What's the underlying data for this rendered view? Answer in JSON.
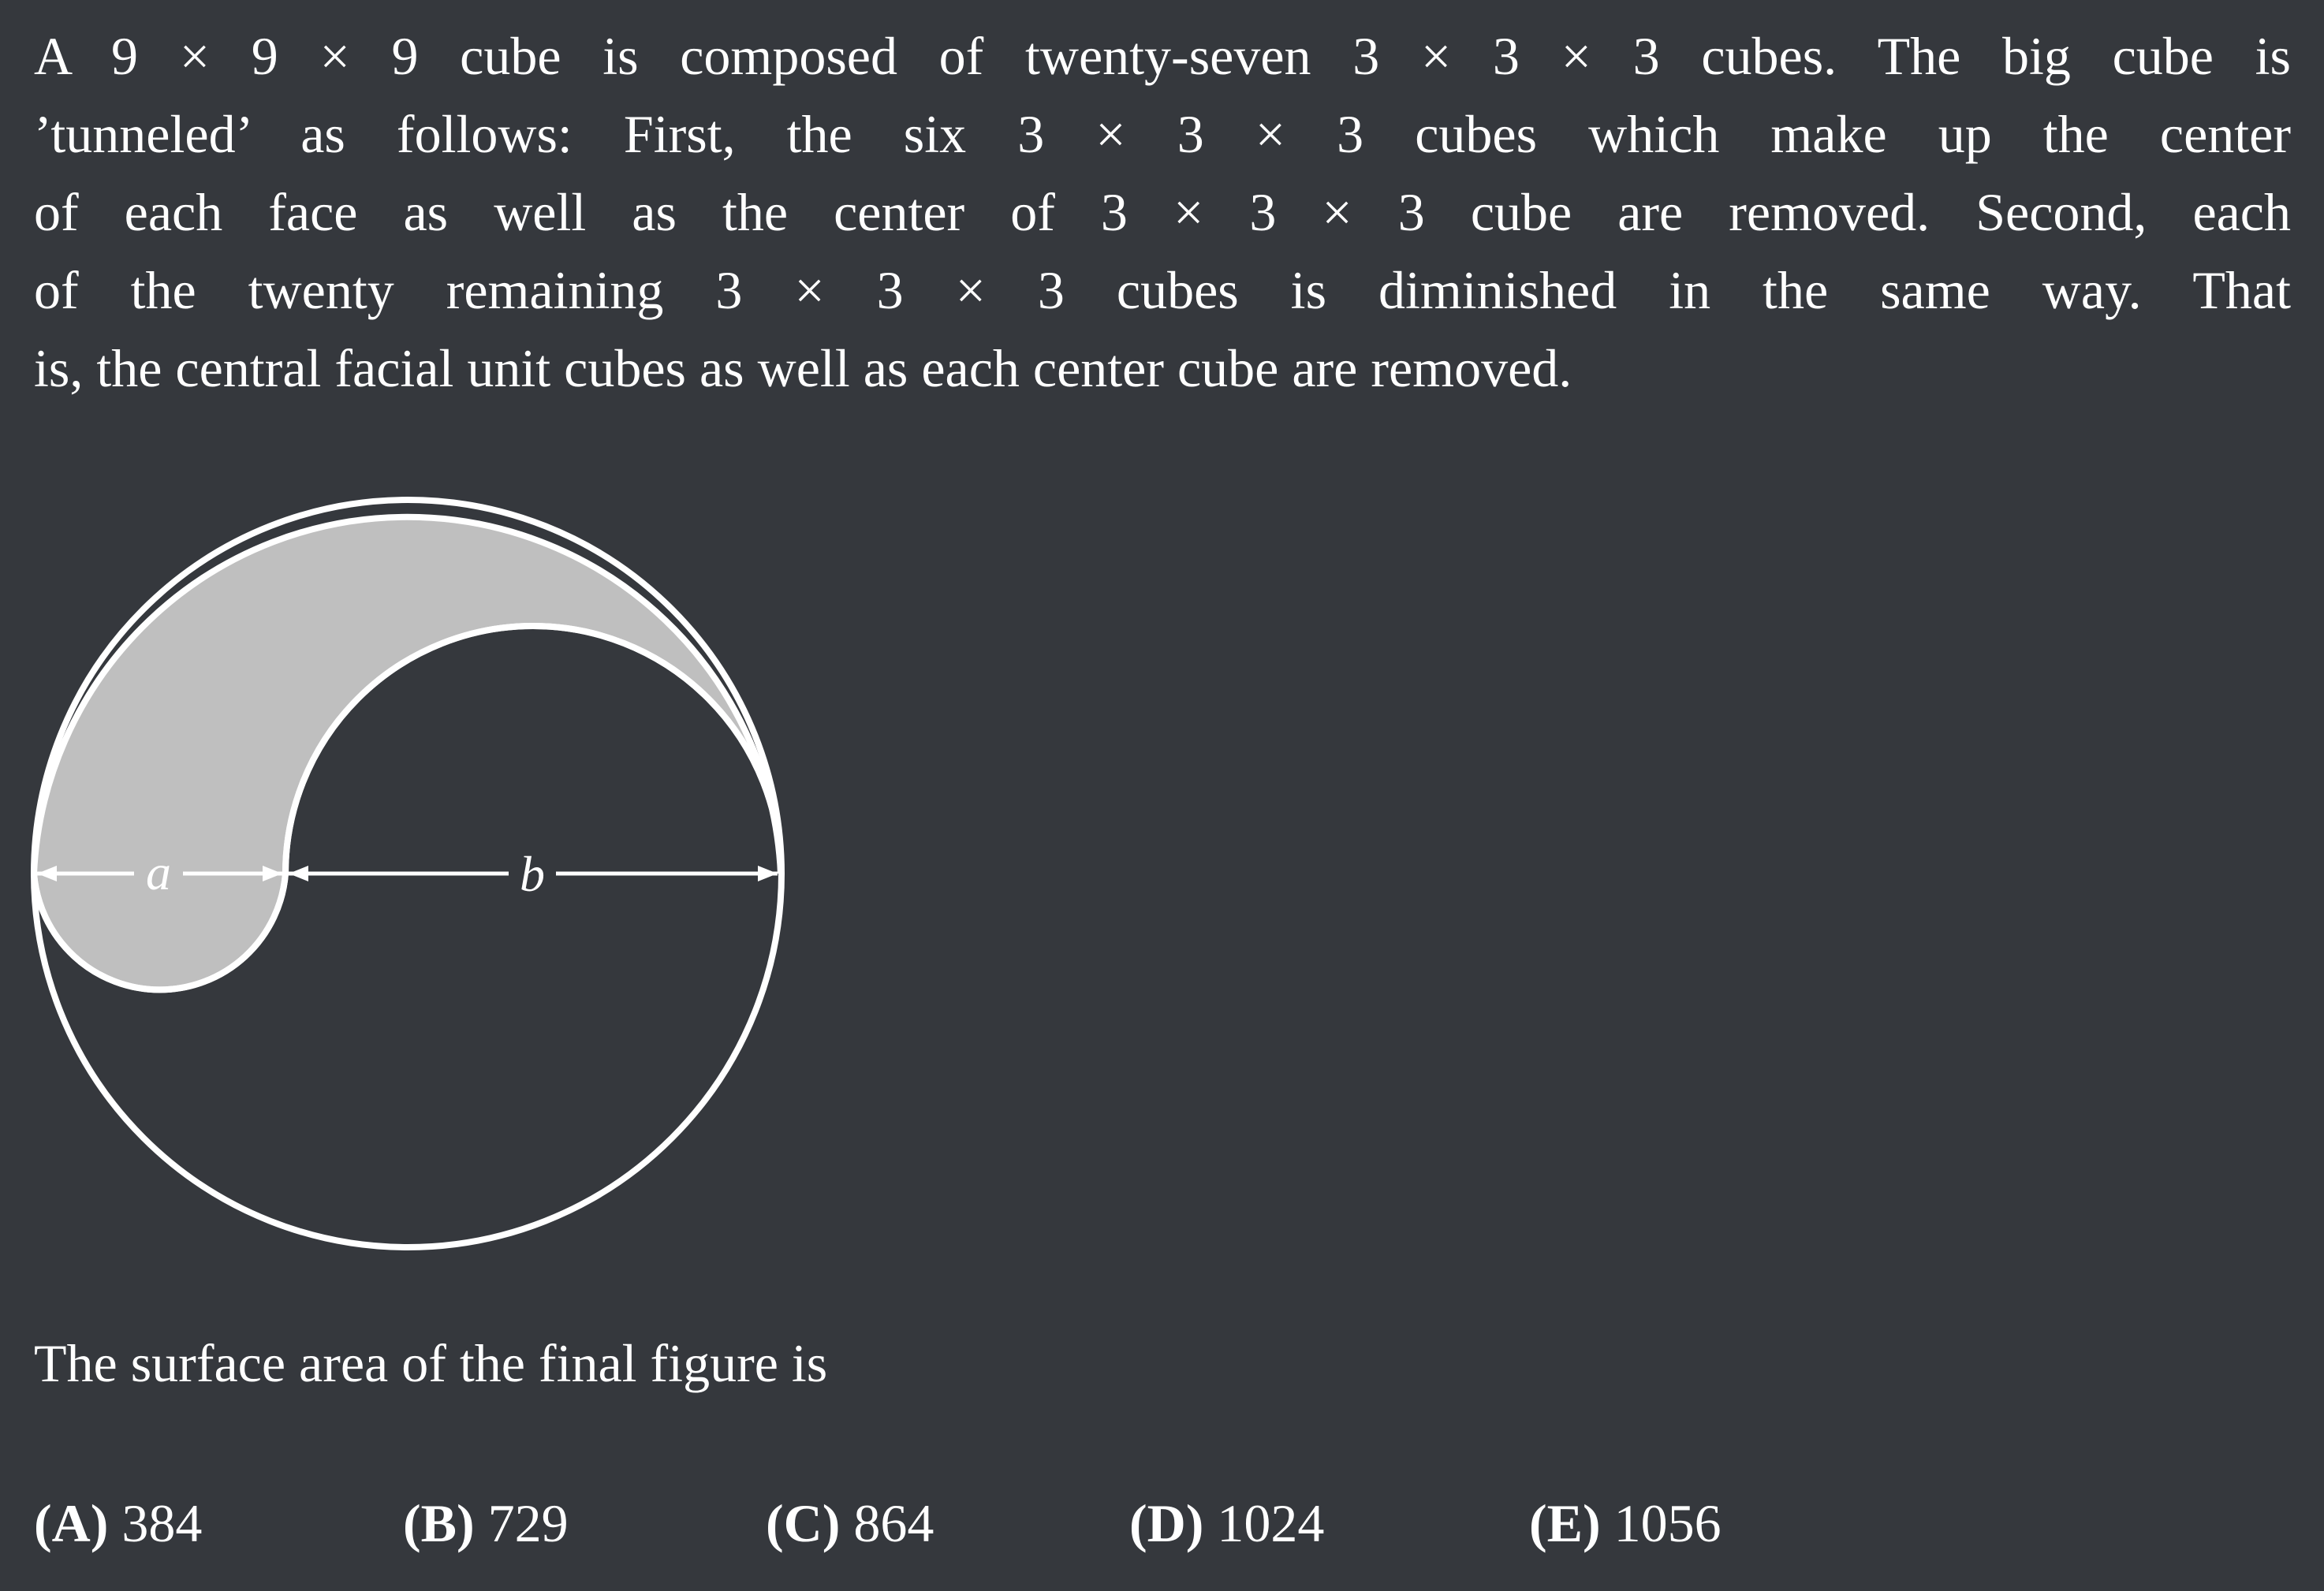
{
  "problem": {
    "lines": [
      "A 9 × 9 × 9 cube is composed of twenty-seven 3 × 3 × 3 cubes. The big cube is",
      "’tunneled’ as follows: First, the six 3 × 3 × 3 cubes which make up the center",
      "of each face as well as the center of 3 × 3 × 3 cube are removed. Second, each",
      "of the twenty remaining 3 × 3 × 3 cubes is diminished in the same way. That",
      "is, the central facial unit cubes as well as each center cube are removed."
    ],
    "question": "The surface area of the final figure is"
  },
  "figure": {
    "label_a": "a",
    "label_b": "b",
    "fill_color": "#bfbfbf",
    "stroke_color": "#ffffff"
  },
  "choices": [
    {
      "letter": "(A)",
      "value": "384"
    },
    {
      "letter": "(B)",
      "value": "729"
    },
    {
      "letter": "(C)",
      "value": "864"
    },
    {
      "letter": "(D)",
      "value": "1024"
    },
    {
      "letter": "(E)",
      "value": "1056"
    }
  ]
}
